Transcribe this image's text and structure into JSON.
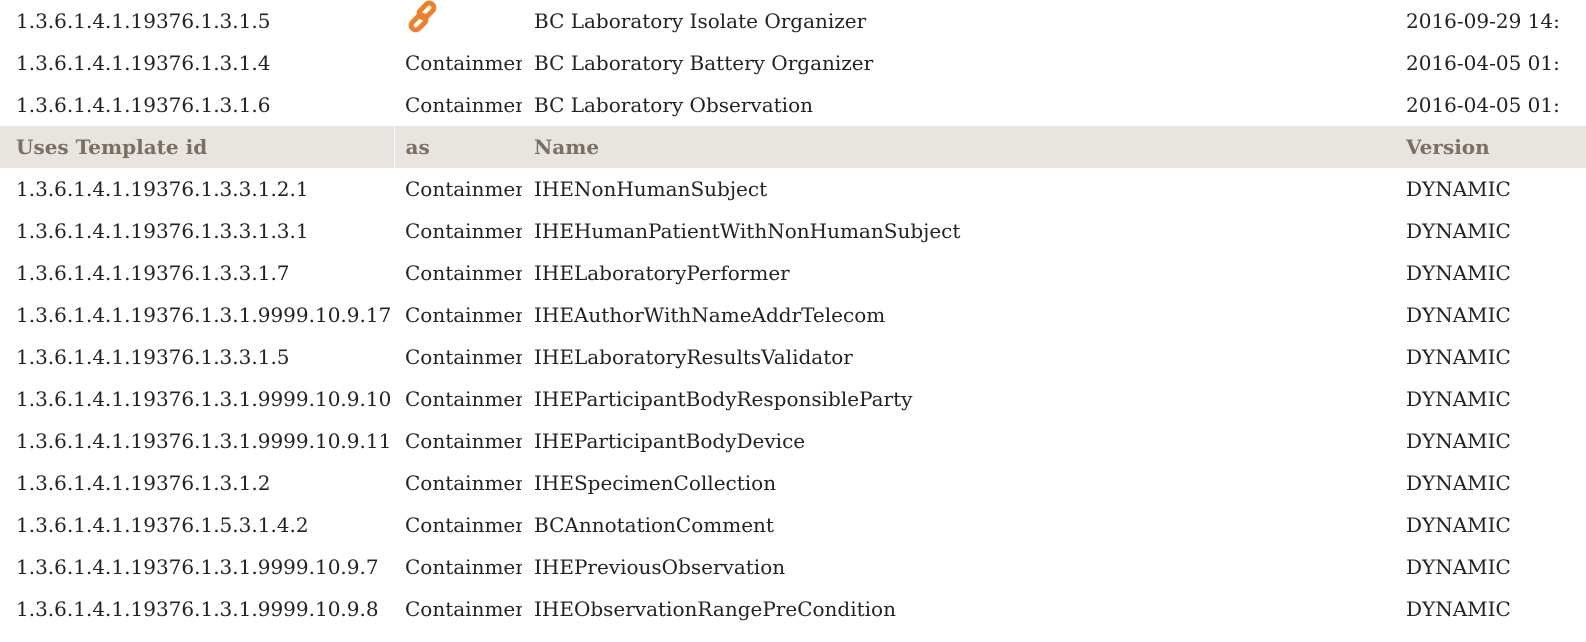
{
  "top_rows": [
    {
      "id": "1.3.6.1.4.1.19376.1.3.1.5",
      "as": "",
      "as_icon": "link-icon",
      "name": "BC Laboratory Isolate Organizer",
      "version": "2016-09-29 14:"
    },
    {
      "id": "1.3.6.1.4.1.19376.1.3.1.4",
      "as": "Containment",
      "name": "BC Laboratory Battery Organizer",
      "version": "2016-04-05 01:"
    },
    {
      "id": "1.3.6.1.4.1.19376.1.3.1.6",
      "as": "Containment",
      "name": "BC Laboratory Observation",
      "version": "2016-04-05 01:"
    }
  ],
  "uses_header": {
    "id": "Uses Template id",
    "as": "as",
    "name": "Name",
    "version": "Version"
  },
  "uses_rows": [
    {
      "id": "1.3.6.1.4.1.19376.1.3.3.1.2.1",
      "as": "Containment",
      "name": "IHENonHumanSubject",
      "version": "DYNAMIC"
    },
    {
      "id": "1.3.6.1.4.1.19376.1.3.3.1.3.1",
      "as": "Containment",
      "name": "IHEHumanPatientWithNonHumanSubject",
      "version": "DYNAMIC"
    },
    {
      "id": "1.3.6.1.4.1.19376.1.3.3.1.7",
      "as": "Containment",
      "name": "IHELaboratoryPerformer",
      "version": "DYNAMIC"
    },
    {
      "id": "1.3.6.1.4.1.19376.1.3.1.9999.10.9.17",
      "as": "Containment",
      "name": "IHEAuthorWithNameAddrTelecom",
      "version": "DYNAMIC"
    },
    {
      "id": "1.3.6.1.4.1.19376.1.3.3.1.5",
      "as": "Containment",
      "name": "IHELaboratoryResultsValidator",
      "version": "DYNAMIC"
    },
    {
      "id": "1.3.6.1.4.1.19376.1.3.1.9999.10.9.10",
      "as": "Containment",
      "name": "IHEParticipantBodyResponsibleParty",
      "version": "DYNAMIC"
    },
    {
      "id": "1.3.6.1.4.1.19376.1.3.1.9999.10.9.11",
      "as": "Containment",
      "name": "IHEParticipantBodyDevice",
      "version": "DYNAMIC"
    },
    {
      "id": "1.3.6.1.4.1.19376.1.3.1.2",
      "as": "Containment",
      "name": "IHESpecimenCollection",
      "version": "DYNAMIC"
    },
    {
      "id": "1.3.6.1.4.1.19376.1.5.3.1.4.2",
      "as": "Containment",
      "name": "BCAnnotationComment",
      "version": "DYNAMIC"
    },
    {
      "id": "1.3.6.1.4.1.19376.1.3.1.9999.10.9.7",
      "as": "Containment",
      "name": "IHEPreviousObservation",
      "version": "DYNAMIC"
    },
    {
      "id": "1.3.6.1.4.1.19376.1.3.1.9999.10.9.8",
      "as": "Containment",
      "name": "IHEObservationRangePreCondition",
      "version": "DYNAMIC"
    }
  ],
  "colors": {
    "header_bg": "#e8e5e0",
    "header_text": "#7b6f63",
    "link_icon": "#f07f2c"
  }
}
